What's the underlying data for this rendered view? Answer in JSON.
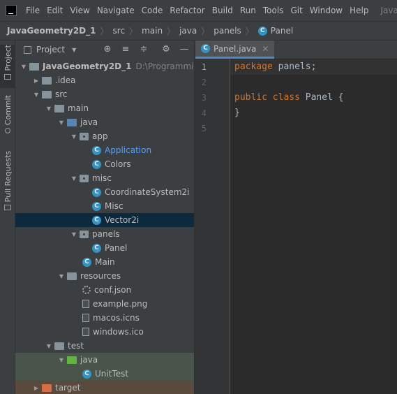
{
  "menubar": {
    "items": [
      "File",
      "Edit",
      "View",
      "Navigate",
      "Code",
      "Refactor",
      "Build",
      "Run",
      "Tools",
      "Git",
      "Window",
      "Help"
    ],
    "window_title": "JavaG"
  },
  "breadcrumb": [
    "JavaGeometry2D_1",
    "src",
    "main",
    "java",
    "panels",
    "Panel"
  ],
  "left_tools": {
    "project": "Project",
    "commit": "Commit",
    "pull_requests": "Pull Requests"
  },
  "project_panel": {
    "title": "Project"
  },
  "tree": {
    "root_name": "JavaGeometry2D_1",
    "root_path": "D:\\Programming\\J",
    "items": [
      {
        "label": "JavaGeometry2D_1"
      },
      {
        "label": ".idea"
      },
      {
        "label": "src"
      },
      {
        "label": "main"
      },
      {
        "label": "java"
      },
      {
        "label": "app"
      },
      {
        "label": "Application"
      },
      {
        "label": "Colors"
      },
      {
        "label": "misc"
      },
      {
        "label": "CoordinateSystem2i"
      },
      {
        "label": "Misc"
      },
      {
        "label": "Vector2i"
      },
      {
        "label": "panels"
      },
      {
        "label": "Panel"
      },
      {
        "label": "Main"
      },
      {
        "label": "resources"
      },
      {
        "label": "conf.json"
      },
      {
        "label": "example.png"
      },
      {
        "label": "macos.icns"
      },
      {
        "label": "windows.ico"
      },
      {
        "label": "test"
      },
      {
        "label": "java"
      },
      {
        "label": "UnitTest"
      },
      {
        "label": "target"
      }
    ],
    "selected_index": 11
  },
  "editor": {
    "tab_label": "Panel.java",
    "line_numbers": [
      "1",
      "2",
      "3",
      "4",
      "5"
    ],
    "code": {
      "l1_kw": "package",
      "l1_rest": " panels;",
      "l3_kw1": "public",
      "l3_kw2": "class",
      "l3_name": "Panel",
      "l3_brace": " {",
      "l4": "}"
    }
  },
  "colors": {
    "accent": "#4a88c7",
    "class_icon": "#3592c4",
    "keyword": "#cc7832",
    "selection": "#0d293e"
  }
}
